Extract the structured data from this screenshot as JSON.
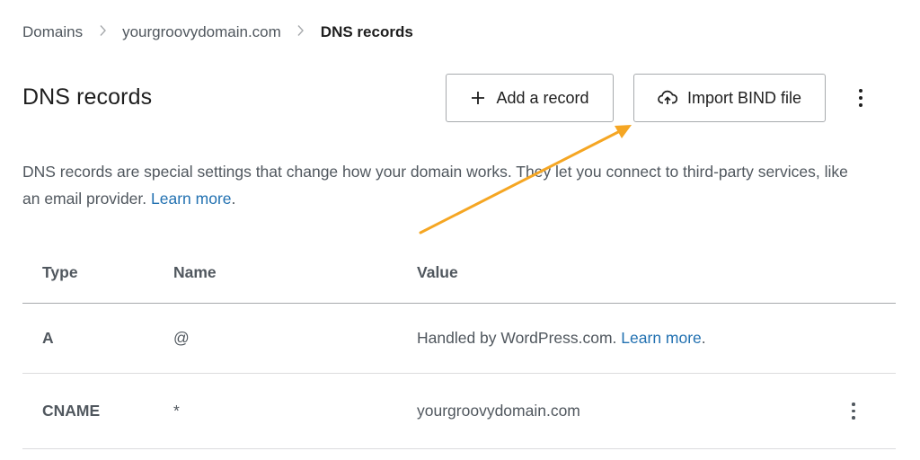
{
  "breadcrumb": {
    "items": [
      "Domains",
      "yourgroovydomain.com",
      "DNS records"
    ],
    "separator": ">"
  },
  "header": {
    "title": "DNS records",
    "add_record_label": "Add a record",
    "import_bind_label": "Import BIND file"
  },
  "description": {
    "text": "DNS records are special settings that change how your domain works. They let you connect to third-party services, like an email provider.",
    "link": "Learn more"
  },
  "table": {
    "columns": [
      "Type",
      "Name",
      "Value"
    ],
    "rows": [
      {
        "type": "A",
        "name": "@",
        "value": "Handled by WordPress.com.",
        "value_link": "Learn more"
      },
      {
        "type": "CNAME",
        "name": "*",
        "value": "yourgroovydomain.com"
      }
    ]
  },
  "colors": {
    "accent": "#2271b1",
    "annotation_arrow": "#f5a623",
    "text": "#1e1e1e",
    "muted": "#50575e",
    "border": "#a7aaad"
  },
  "icons": {
    "add": "plus-icon",
    "import": "cloud-upload-icon",
    "more": "more-vertical-icon"
  }
}
